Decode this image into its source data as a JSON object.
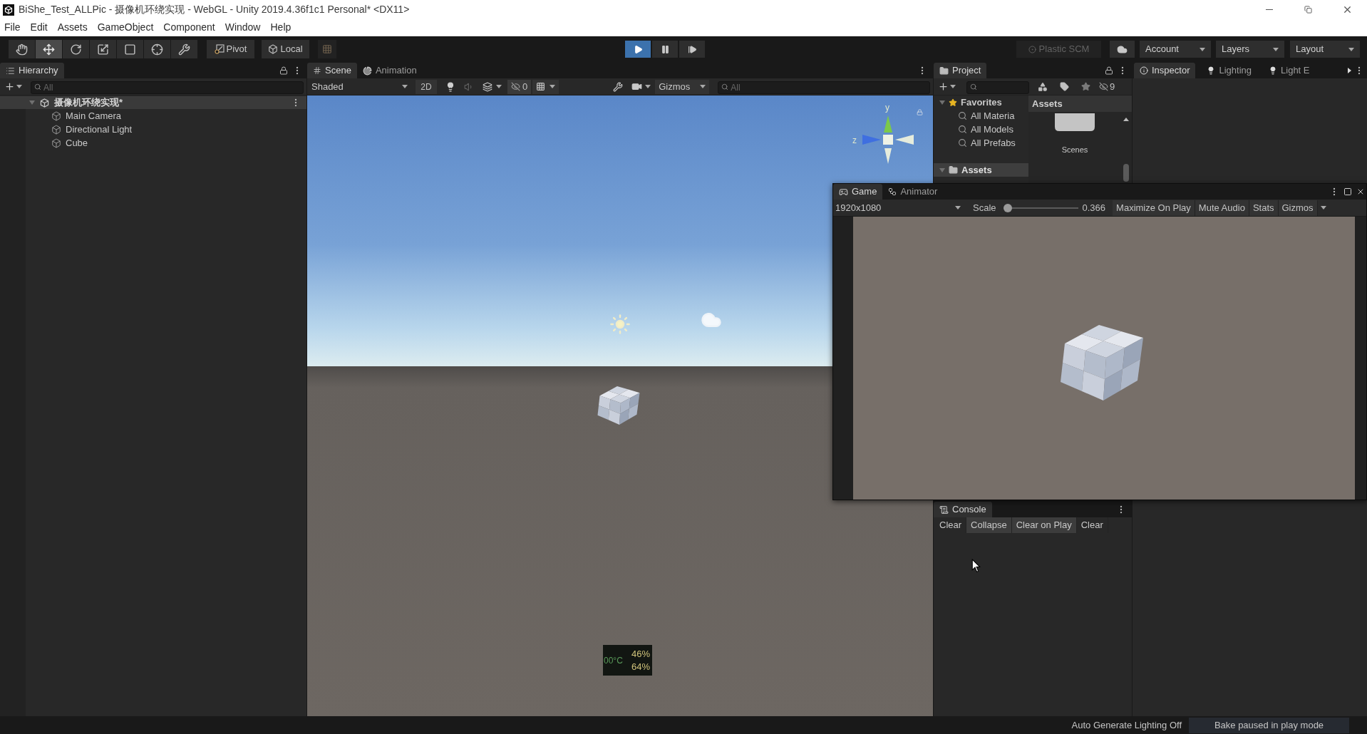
{
  "window": {
    "title": "BiShe_Test_ALLPic - 摄像机环绕实现 - WebGL - Unity 2019.4.36f1c1 Personal* <DX11>"
  },
  "menu": [
    "File",
    "Edit",
    "Assets",
    "GameObject",
    "Component",
    "Window",
    "Help"
  ],
  "toolbar": {
    "tools": [
      {
        "kind": "hand",
        "selected": false
      },
      {
        "kind": "move",
        "selected": true
      },
      {
        "kind": "rotate",
        "selected": false
      },
      {
        "kind": "scale",
        "selected": false
      },
      {
        "kind": "rect",
        "selected": false
      },
      {
        "kind": "transform",
        "selected": false
      },
      {
        "kind": "custom",
        "selected": false
      }
    ],
    "pivot": "Pivot",
    "space": "Local",
    "playback": [
      {
        "kind": "play",
        "selected": true
      },
      {
        "kind": "pause",
        "selected": false
      },
      {
        "kind": "step",
        "selected": false
      }
    ],
    "plastic_scm": {
      "label": "Plastic SCM",
      "disabled": true
    },
    "dropdowns": [
      "Account",
      "Layers",
      "Layout"
    ]
  },
  "hierarchy": {
    "tab": {
      "label": "Hierarchy",
      "selected": true
    },
    "search": {
      "placeholder": "All"
    },
    "scene": {
      "name": "摄像机环绕实现*",
      "expanded": true,
      "children": [
        {
          "name": "Main Camera"
        },
        {
          "name": "Directional Light"
        },
        {
          "name": "Cube"
        }
      ]
    }
  },
  "scene_view": {
    "tabs": [
      {
        "label": "Scene",
        "selected": true
      },
      {
        "label": "Animation",
        "selected": false
      }
    ],
    "shading": "Shaded",
    "mode_2d": "2D",
    "hidden_count": "0",
    "gizmos": "Gizmos",
    "search": {
      "placeholder": "All"
    },
    "gizmo_axes": [
      "y",
      "z"
    ],
    "monitor": {
      "temperature": "00°C",
      "readings": [
        "46%",
        "64%"
      ]
    }
  },
  "project": {
    "tab": {
      "label": "Project",
      "selected": true
    },
    "hidden_count": "9",
    "favorites": {
      "label": "Favorites",
      "expanded": true,
      "selected": false,
      "children": [
        {
          "name": "All Materia",
          "selected": false
        },
        {
          "name": "All Models",
          "selected": false
        },
        {
          "name": "All Prefabs",
          "selected": false
        }
      ]
    },
    "assets": {
      "label": "Assets",
      "expanded": true,
      "selected": true
    },
    "grid": {
      "title": "Assets",
      "items": [
        {
          "name": "Scenes"
        }
      ]
    }
  },
  "inspector": {
    "tabs": [
      {
        "label": "Inspector",
        "selected": true
      },
      {
        "label": "Lighting",
        "selected": false
      },
      {
        "label": "Light E",
        "selected": false
      }
    ]
  },
  "game": {
    "tabs": [
      {
        "label": "Game",
        "selected": true
      },
      {
        "label": "Animator",
        "selected": false
      }
    ],
    "resolution": "1920x1080",
    "scale": {
      "label": "Scale",
      "level": 0,
      "reading": "0.366"
    },
    "buttons": [
      "Maximize On Play",
      "Mute Audio",
      "Stats",
      "Gizmos"
    ]
  },
  "console": {
    "tab": {
      "label": "Console",
      "selected": true
    },
    "buttons": [
      {
        "label": "Clear",
        "on": false
      },
      {
        "label": "Collapse",
        "on": true
      },
      {
        "label": "Clear on Play",
        "on": true
      },
      {
        "label": "Clear",
        "on": false
      }
    ]
  },
  "status_bar": {
    "lighting": "Auto Generate Lighting Off",
    "bake": "Bake paused in play mode"
  }
}
